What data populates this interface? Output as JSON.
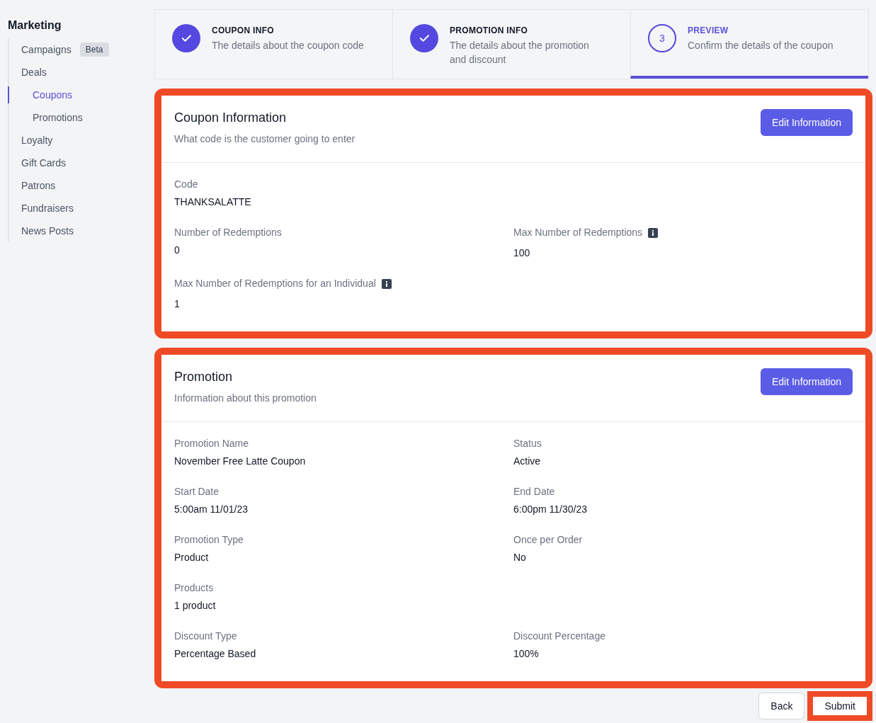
{
  "sidebar": {
    "title": "Marketing",
    "items": [
      {
        "label": "Campaigns",
        "badge": "Beta",
        "selected": false
      },
      {
        "label": "Deals",
        "selected": false,
        "children": [
          {
            "label": "Coupons",
            "selected": true
          },
          {
            "label": "Promotions",
            "selected": false
          }
        ]
      },
      {
        "label": "Loyalty",
        "selected": false
      },
      {
        "label": "Gift Cards",
        "selected": false
      },
      {
        "label": "Patrons",
        "selected": false
      },
      {
        "label": "Fundraisers",
        "selected": false
      },
      {
        "label": "News Posts",
        "selected": false
      }
    ]
  },
  "steps": [
    {
      "title": "COUPON INFO",
      "description": "The details about the coupon code",
      "complete": true,
      "selected": false
    },
    {
      "title": "PROMOTION INFO",
      "description": "The details about the promotion and discount",
      "complete": true,
      "selected": false
    },
    {
      "title": "PREVIEW",
      "description": "Confirm the details of the coupon",
      "marker": "3",
      "complete": false,
      "selected": true
    }
  ],
  "cards": [
    {
      "title": "Coupon Information",
      "subtitle": "What code is the customer going to enter",
      "button": "Edit Information",
      "highlighted": true,
      "rows": [
        [
          {
            "label": "Code",
            "value": "THANKSALATTE",
            "info": false
          }
        ],
        [
          {
            "label": "Number of Redemptions",
            "value": "0",
            "info": false
          },
          {
            "label": "Max Number of Redemptions",
            "value": "100",
            "info": true
          }
        ],
        [
          {
            "label": "Max Number of Redemptions for an Individual",
            "value": "1",
            "info": true
          }
        ]
      ]
    },
    {
      "title": "Promotion",
      "subtitle": "Information about this promotion",
      "button": "Edit Information",
      "highlighted": true,
      "rows": [
        [
          {
            "label": "Promotion Name",
            "value": "November Free Latte Coupon",
            "info": false
          },
          {
            "label": "Status",
            "value": "Active",
            "info": false
          }
        ],
        [
          {
            "label": "Start Date",
            "value": "5:00am 11/01/23",
            "info": false
          },
          {
            "label": "End Date",
            "value": "6:00pm 11/30/23",
            "info": false
          }
        ],
        [
          {
            "label": "Promotion Type",
            "value": "Product",
            "info": false
          },
          {
            "label": "Once per Order",
            "value": "No",
            "info": false
          }
        ],
        [
          {
            "label": "Products",
            "value": "1 product",
            "info": false
          }
        ],
        [
          {
            "label": "Discount Type",
            "value": "Percentage Based",
            "info": false
          },
          {
            "label": "Discount Percentage",
            "value": "100%",
            "info": false
          }
        ]
      ]
    }
  ],
  "actions": [
    {
      "label": "Back",
      "highlighted": false
    },
    {
      "label": "Submit",
      "highlighted": true
    }
  ]
}
